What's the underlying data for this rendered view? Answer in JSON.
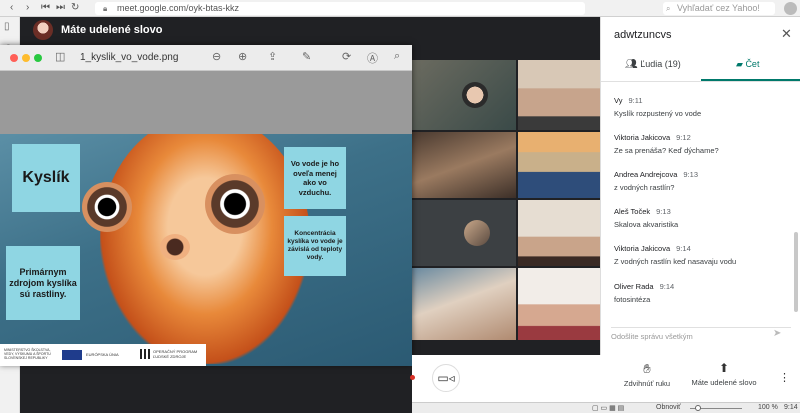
{
  "browser": {
    "url": "meet.google.com/oyk-btas-kkz",
    "search_placeholder": "Vyhľadať cez Yahoo!",
    "nav_icons": [
      "back-icon",
      "forward-icon",
      "first-icon",
      "last-icon",
      "reload-icon",
      "home-icon"
    ]
  },
  "meet": {
    "presenter_label": "Máte udelené slovo"
  },
  "preview": {
    "filename": "1_kyslik_vo_vode.png",
    "slide": {
      "title": "Kyslík",
      "left_text": "Primárnym zdrojom kyslíka sú rastliny.",
      "right_top": "Vo vode je ho oveľa menej ako vo vzduchu.",
      "right_bottom": "Koncentrácia kyslíka vo vode je závislá od teploty vody.",
      "footer_left": "MINISTERSTVO ŠKOLSTVA, VEDY, VÝSKUMU A ŠPORTU SLOVENSKEJ REPUBLIKY",
      "footer_mid": "EURÓPSKA ÚNIA",
      "footer_right": "OPERAČNÝ PROGRAM ĽUDSKÉ ZDROJE"
    }
  },
  "chat": {
    "title": "adwtzuncvs",
    "tab_people": "Ľudia (19)",
    "tab_chat": "Čet",
    "input_placeholder": "Odošlite správu všetkým",
    "messages": [
      {
        "sender": "Vy",
        "time": "9:11",
        "text": "Kyslík rozpustený vo vode"
      },
      {
        "sender": "Viktoria Jakicova",
        "time": "9:12",
        "text": "Ze sa prenáša? Keď dýchame?"
      },
      {
        "sender": "Andrea Andrejcova",
        "time": "9:13",
        "text": "z vodných rastlín?"
      },
      {
        "sender": "Aleš Toček",
        "time": "9:13",
        "text": "Skalova akvaristika"
      },
      {
        "sender": "Viktoria Jakicova",
        "time": "9:14",
        "text": "Z vodných rastlín keď nasavaju vodu"
      },
      {
        "sender": "Oliver Rada",
        "time": "9:14",
        "text": "fotosintéza"
      }
    ]
  },
  "controls": {
    "raise_hand": "Zdvihnúť ruku",
    "present": "Máte udelené slovo"
  },
  "status": {
    "reload": "Obnoviť",
    "zoom": "100 %",
    "time": "9:14"
  },
  "colors": {
    "meet_bg": "#202124",
    "accent_teal": "#00796b",
    "slide_box": "#8fd6e3"
  }
}
